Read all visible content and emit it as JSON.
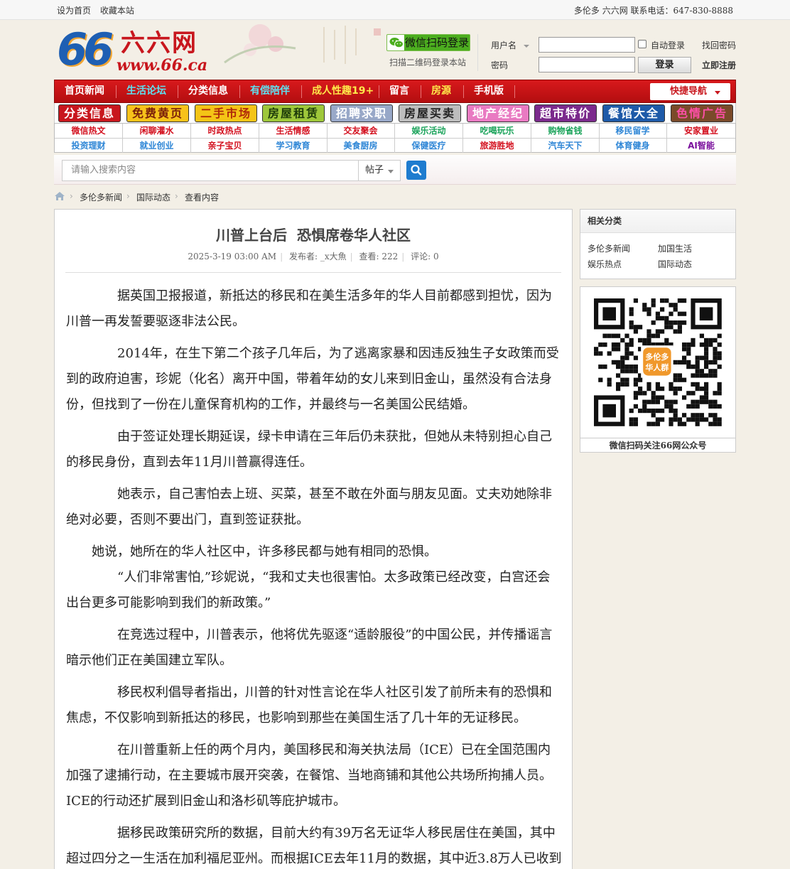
{
  "topbar": {
    "set_home": "设为首页",
    "bookmark": "收藏本站",
    "contact": "多伦多 六六网 联系电话：647-830-8888"
  },
  "header": {
    "logo_number": "66",
    "logo_cn": "六六网",
    "logo_url": "www.66.ca",
    "wechat_login": "微信扫码登录",
    "wechat_sub": "扫描二维码登录本站",
    "username_label": "用户名",
    "password_label": "密码",
    "auto_login": "自动登录",
    "forgot": "找回密码",
    "login": "登录",
    "register": "立即注册"
  },
  "nav": {
    "items": [
      {
        "label": "首页新闻",
        "color": "#ffffff"
      },
      {
        "label": "生活论坛",
        "color": "#5fe0f0"
      },
      {
        "label": "分类信息",
        "color": "#ffffff"
      },
      {
        "label": "有偿陪伴",
        "color": "#5fe0f0"
      },
      {
        "label": "成人性趣19+",
        "color": "#ffe94a"
      },
      {
        "label": "留言",
        "color": "#ffffff"
      },
      {
        "label": "房源",
        "color": "#ffe94a"
      },
      {
        "label": "手机版",
        "color": "#ffffff"
      }
    ],
    "quick_nav": "快捷导航"
  },
  "banners": [
    {
      "label": "分类信息",
      "bg": "#c8161d",
      "fg": "#ffffff"
    },
    {
      "label": "免费黄页",
      "bg": "#f7c21a",
      "fg": "#7a1f0a"
    },
    {
      "label": "二手市场",
      "bg": "#f4c416",
      "fg": "#b02a0a"
    },
    {
      "label": "房屋租赁",
      "bg": "#9ec73a",
      "fg": "#1d3b0a"
    },
    {
      "label": "招聘求职",
      "bg": "#98a8c8",
      "fg": "#ffffff"
    },
    {
      "label": "房屋买卖",
      "bg": "#bdbdbd",
      "fg": "#222222"
    },
    {
      "label": "地产经纪",
      "bg": "#e97ac2",
      "fg": "#ffffff"
    },
    {
      "label": "超市特价",
      "bg": "#7b2a8c",
      "fg": "#ffffff"
    },
    {
      "label": "餐馆大全",
      "bg": "#1e5aa8",
      "fg": "#ffffff"
    },
    {
      "label": "色情广告",
      "bg": "#7a4a2a",
      "fg": "#ff4fa8"
    }
  ],
  "grid": {
    "row1": [
      {
        "label": "微信热文",
        "color": "#d3101e"
      },
      {
        "label": "闲聊灌水",
        "color": "#d3101e"
      },
      {
        "label": "时政热点",
        "color": "#d3101e"
      },
      {
        "label": "生活情感",
        "color": "#d3101e"
      },
      {
        "label": "交友聚会",
        "color": "#d3101e"
      },
      {
        "label": "娱乐活动",
        "color": "#1aa35a"
      },
      {
        "label": "吃喝玩乐",
        "color": "#1aa35a"
      },
      {
        "label": "购物省钱",
        "color": "#1aa35a"
      },
      {
        "label": "移民留学",
        "color": "#2e86d6"
      },
      {
        "label": "安家置业",
        "color": "#d3101e"
      }
    ],
    "row2": [
      {
        "label": "投资理财",
        "color": "#2e86d6"
      },
      {
        "label": "就业创业",
        "color": "#2e86d6"
      },
      {
        "label": "亲子宝贝",
        "color": "#d3101e"
      },
      {
        "label": "学习教育",
        "color": "#2e86d6"
      },
      {
        "label": "美食厨房",
        "color": "#2e86d6"
      },
      {
        "label": "保健医疗",
        "color": "#2e86d6"
      },
      {
        "label": "旅游胜地",
        "color": "#d3101e"
      },
      {
        "label": "汽车天下",
        "color": "#2e86d6"
      },
      {
        "label": "体育健身",
        "color": "#2e86d6"
      },
      {
        "label": "AI智能",
        "color": "#7a0f9c"
      }
    ]
  },
  "search": {
    "placeholder": "请输入搜索内容",
    "type": "帖子"
  },
  "breadcrumb": [
    "多伦多新闻",
    "国际动态",
    "查看内容"
  ],
  "article": {
    "title": "川普上台后  恐惧席卷华人社区",
    "date": "2025-3-19 03:00 AM",
    "author_label": "发布者:",
    "author": "_x大魚",
    "views_label": "查看:",
    "views": "222",
    "comments_label": "评论:",
    "comments": "0",
    "paragraphs": [
      "据英国卫报报道，新抵达的移民和在美生活多年的华人目前都感到担忧，因为川普一再发誓要驱逐非法公民。",
      "2014年，在生下第二个孩子几年后，为了逃离家暴和因违反独生子女政策而受到的政府迫害，珍妮（化名）离开中国，带着年幼的女儿来到旧金山，虽然没有合法身份，但找到了一份在儿童保育机构的工作，并最终与一名美国公民结婚。",
      "由于签证处理长期延误，绿卡申请在三年后仍未获批，但她从未特别担心自己的移民身份，直到去年11月川普赢得连任。",
      "她表示，自己害怕去上班、买菜，甚至不敢在外面与朋友见面。丈夫劝她除非绝对必要，否则不要出门，直到签证获批。",
      "她说，她所在的华人社区中，许多移民都与她有相同的恐惧。",
      "“人们非常害怕,”珍妮说，“我和丈夫也很害怕。太多政策已经改变，白宫还会出台更多可能影响到我们的新政策。”",
      "在竞选过程中，川普表示，他将优先驱逐“适龄服役”的中国公民，并传播谣言暗示他们正在美国建立军队。",
      "移民权利倡导者指出，川普的针对性言论在华人社区引发了前所未有的恐惧和焦虑，不仅影响到新抵达的移民，也影响到那些在美国生活了几十年的无证移民。",
      "在川普重新上任的两个月内，美国移民和海关执法局（ICE）已在全国范围内加强了逮捕行动，在主要城市展开突袭，在餐馆、当地商铺和其他公共场所拘捕人员。ICE的行动还扩展到旧金山和洛杉矶等庇护城市。",
      "据移民政策研究所的数据，目前大约有39万名无证华人移民居住在美国，其中超过四分之一生活在加利福尼亚州。而根据ICE去年11月的数据，其中近3.8万人已收到"
    ]
  },
  "sidebar": {
    "related_title": "相关分类",
    "related": [
      "多伦多新闻",
      "加国生活",
      "娱乐热点",
      "国际动态"
    ],
    "qr_badge_line1": "多伦多",
    "qr_badge_line2": "华人群",
    "qr_caption": "微信扫码关注66网公众号"
  },
  "icons": {
    "wechat": "wechat-icon",
    "search": "search-icon",
    "home": "home-icon",
    "qr": "qr-code-image"
  }
}
